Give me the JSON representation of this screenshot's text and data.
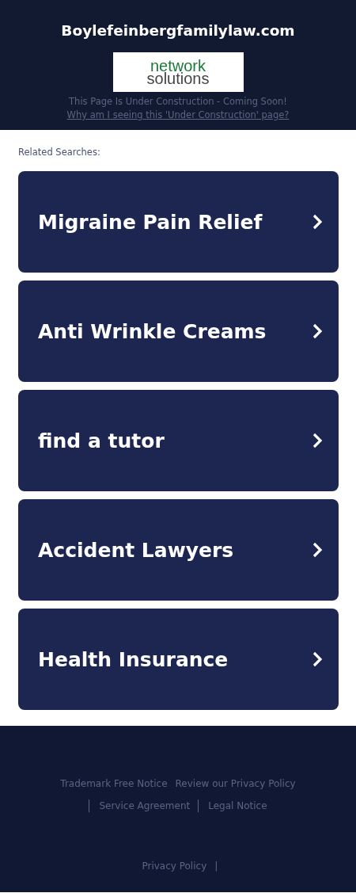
{
  "header": {
    "domain": "Boylefeinbergfamilylaw.com",
    "logo": {
      "line_1": "network",
      "line_2": "solutions"
    },
    "notice": "This Page Is Under Construction - Coming Soon!",
    "why_link": "Why am I seeing this 'Under Construction' page?"
  },
  "related": {
    "title": "Related Searches:",
    "items": [
      {
        "label": "Migraine Pain Relief"
      },
      {
        "label": "Anti Wrinkle Creams"
      },
      {
        "label": "find a tutor"
      },
      {
        "label": "Accident Lawyers"
      },
      {
        "label": "Health Insurance"
      }
    ]
  },
  "footer": {
    "links": [
      {
        "label": "Trademark Free Notice",
        "divider": false
      },
      {
        "label": "Review our Privacy Policy",
        "divider": false
      },
      {
        "label": "Service Agreement",
        "divider": true
      },
      {
        "label": "Legal Notice",
        "divider": true
      }
    ],
    "bottom_link": "Privacy Policy",
    "bottom_separator": "|"
  }
}
